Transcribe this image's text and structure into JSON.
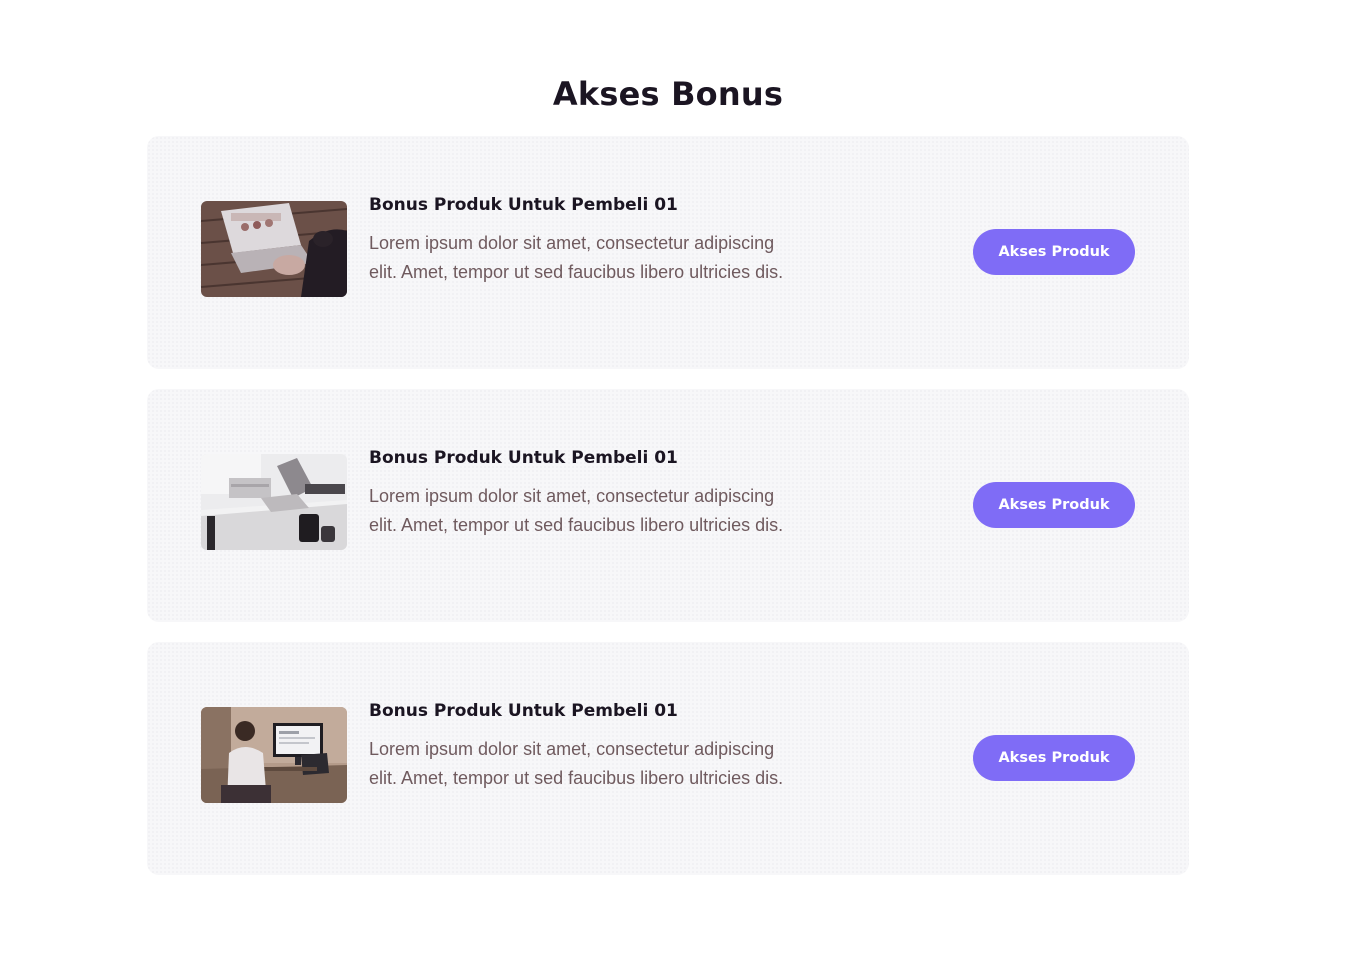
{
  "section": {
    "title": "Akses Bonus"
  },
  "colors": {
    "accent": "#7f6cf6",
    "card_background": "#f7f7f9",
    "title_text": "#1b1522",
    "body_text": "#6f5a5e"
  },
  "cards": [
    {
      "image": "laptop-on-wooden-table-photo",
      "title": "Bonus Produk Untuk Pembeli 01",
      "description": "Lorem ipsum dolor sit amet, consectetur adipiscing elit. Amet, tempor ut sed faucibus libero ultricies dis.",
      "button_label": "Akses Produk"
    },
    {
      "image": "white-desk-with-laptop-photo",
      "title": "Bonus Produk Untuk Pembeli 01",
      "description": "Lorem ipsum dolor sit amet, consectetur adipiscing elit. Amet, tempor ut sed faucibus libero ultricies dis.",
      "button_label": "Akses Produk"
    },
    {
      "image": "person-at-desktop-monitor-photo",
      "title": "Bonus Produk Untuk Pembeli 01",
      "description": "Lorem ipsum dolor sit amet, consectetur adipiscing elit. Amet, tempor ut sed faucibus libero ultricies dis.",
      "button_label": "Akses Produk"
    }
  ]
}
